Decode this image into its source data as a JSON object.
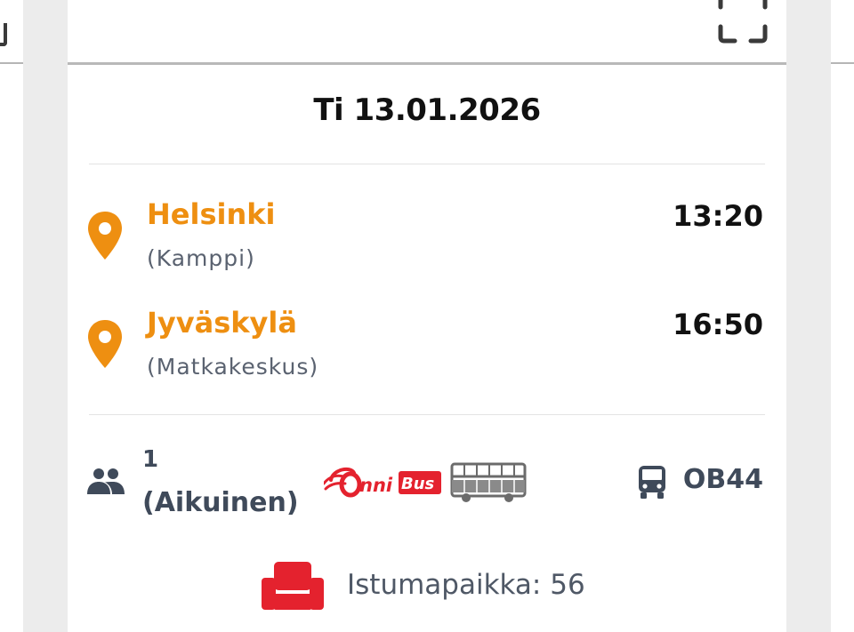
{
  "ticket": {
    "date": "Ti 13.01.2026",
    "departure": {
      "city": "Helsinki",
      "station": "(Kamppi)",
      "time": "13:20"
    },
    "arrival": {
      "city": "Jyväskylä",
      "station": "(Matkakeskus)",
      "time": "16:50"
    },
    "passengers": {
      "count": "1",
      "type": "(Aikuinen)"
    },
    "operator": {
      "logo_text": "OnniBus",
      "logo_text_onni": "nni",
      "logo_text_bus": "Bus"
    },
    "route": "OB44",
    "seat": "Istumapaikka: 56"
  },
  "colors": {
    "accent_orange": "#ee8f11",
    "brand_red": "#e4222e",
    "text_slate": "#3f4a5a",
    "icons": [
      "scan-icon",
      "location-pin-icon",
      "people-icon",
      "bus-icon",
      "seat-icon",
      "double-decker-bus-icon"
    ]
  }
}
